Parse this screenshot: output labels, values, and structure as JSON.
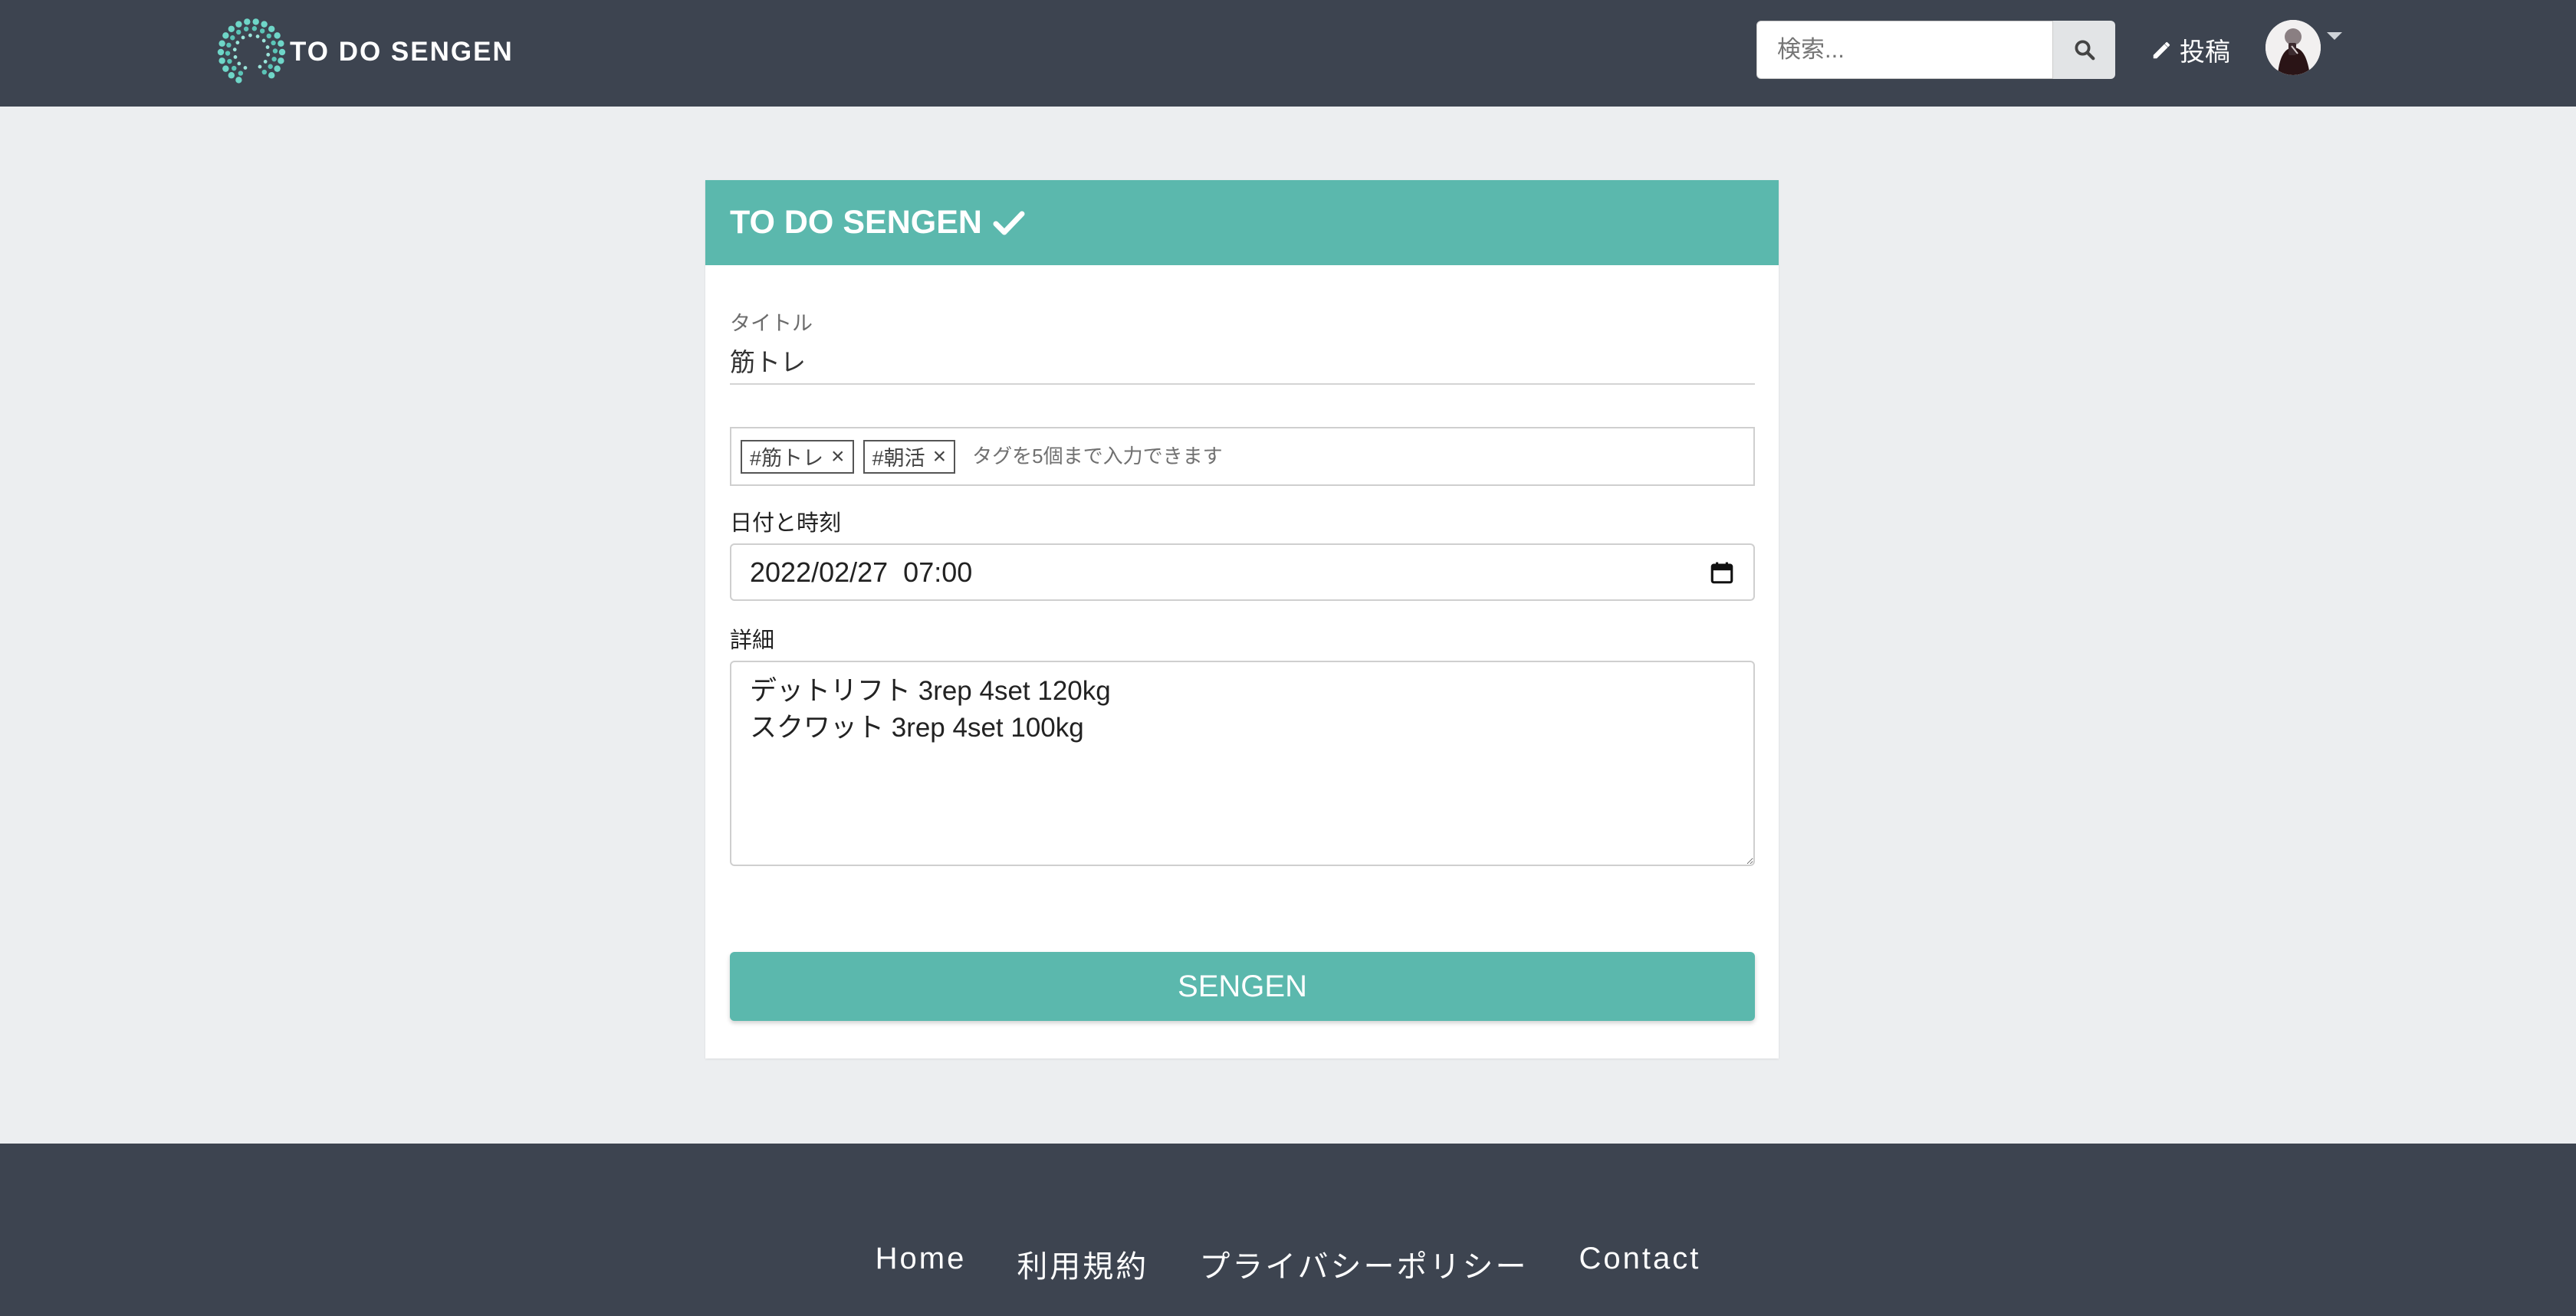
{
  "navbar": {
    "brand": "TO DO SENGEN",
    "search_placeholder": "検索...",
    "post_label": "投稿"
  },
  "form": {
    "header_title": "TO DO SENGEN",
    "title_label": "タイトル",
    "title_value": "筋トレ",
    "tags": [
      "#筋トレ",
      "#朝活"
    ],
    "tag_placeholder": "タグを5個まで入力できます",
    "datetime_label": "日付と時刻",
    "datetime_value": "2022/02/27  07:00",
    "details_label": "詳細",
    "details_value": "デットリフト 3rep 4set 120kg\nスクワット 3rep 4set 100kg",
    "submit_label": "SENGEN"
  },
  "footer": {
    "links": [
      "Home",
      "利用規約",
      "プライバシーポリシー",
      "Contact"
    ]
  },
  "colors": {
    "navbar_bg": "#3d4450",
    "accent": "#5bb8ad",
    "page_bg": "#eceef0"
  },
  "icons": {
    "brand": "dotted-circle-logo",
    "header_check": "check-icon",
    "search": "search-icon",
    "post": "pencil-icon",
    "calendar": "calendar-icon",
    "tag_remove": "close-icon"
  }
}
